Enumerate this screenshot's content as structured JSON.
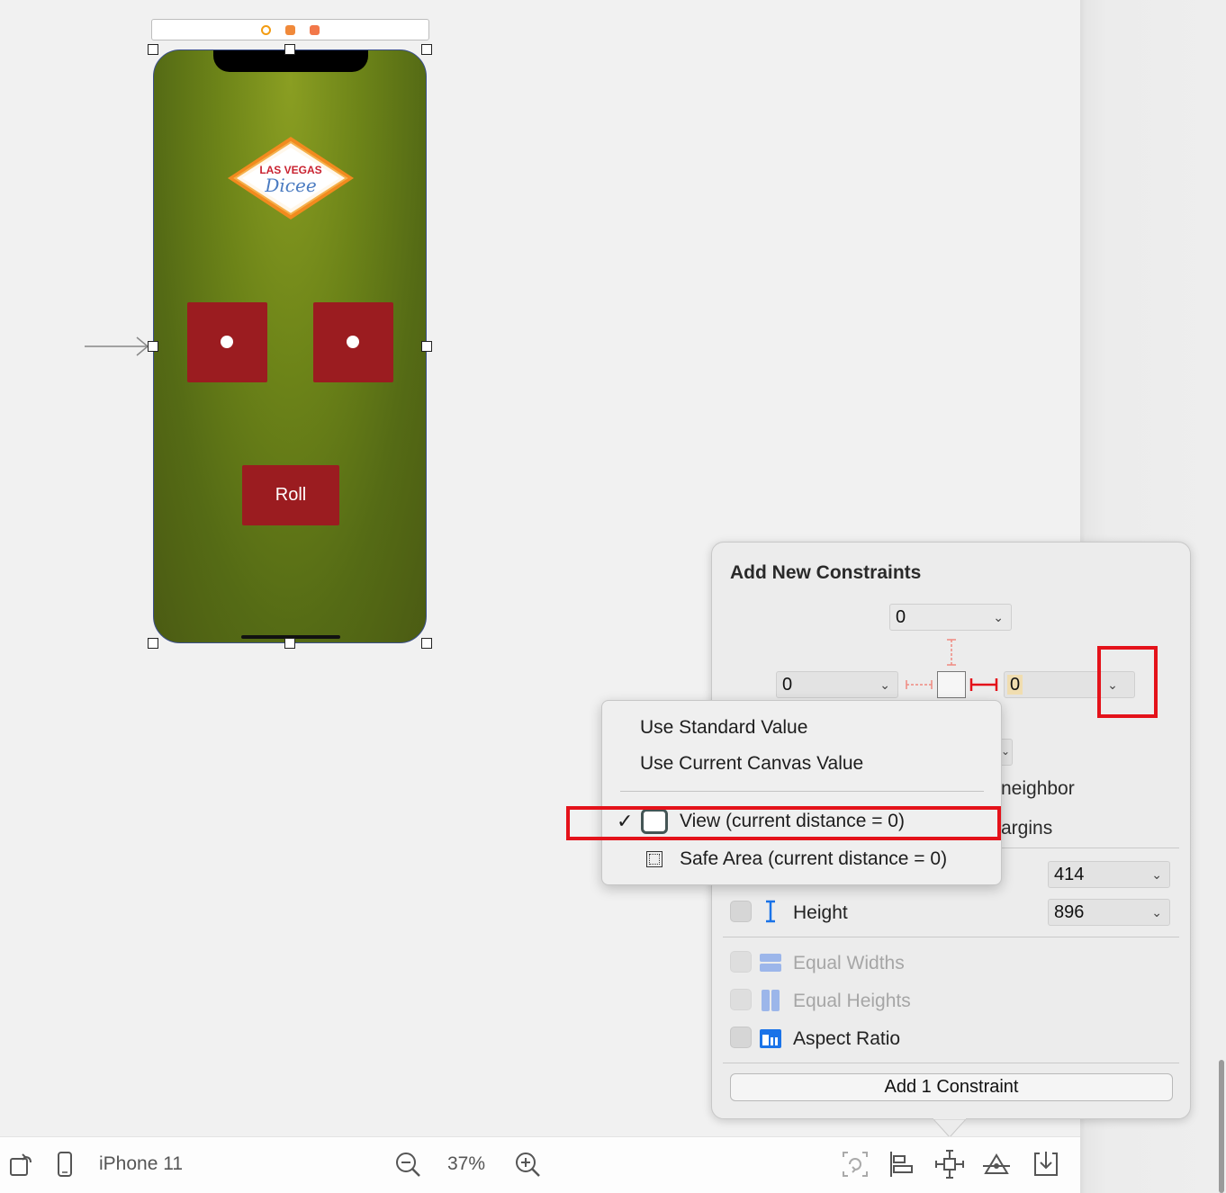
{
  "canvas": {
    "logo_line1": "LAS VEGAS",
    "logo_line2": "Dicee",
    "roll_button_label": "Roll"
  },
  "popover": {
    "title": "Add New Constraints",
    "top_value": "0",
    "left_value": "0",
    "right_value": "0",
    "behind_text_neighbor": "neighbor",
    "behind_text_margins": "argins",
    "width_value": "414",
    "height_label": "Height",
    "height_value": "896",
    "equal_widths_label": "Equal Widths",
    "equal_heights_label": "Equal Heights",
    "aspect_ratio_label": "Aspect Ratio",
    "add_button_label": "Add 1 Constraint"
  },
  "context_menu": {
    "items": [
      {
        "label": "Use Standard Value"
      },
      {
        "label": "Use Current Canvas Value"
      },
      {
        "label": "View (current distance = 0)",
        "checked": true
      },
      {
        "label": "Safe Area (current distance = 0)",
        "checked": false
      }
    ]
  },
  "toolbar": {
    "device_label": "iPhone 11",
    "zoom_label": "37%"
  },
  "colors": {
    "highlight": "#e4121a",
    "dice": "#9b1c20",
    "felt": "#6c8318",
    "accent_blue": "#1a73e8"
  }
}
